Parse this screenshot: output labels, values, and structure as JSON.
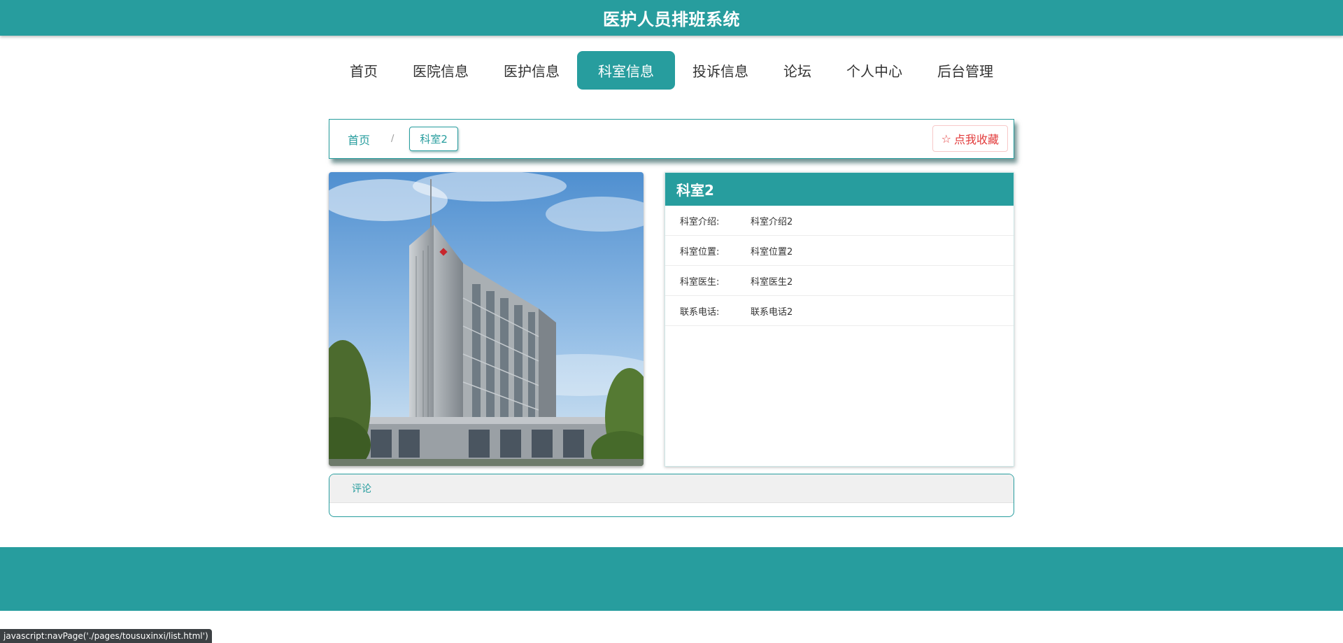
{
  "header": {
    "title": "医护人员排班系统"
  },
  "nav": {
    "items": [
      {
        "label": "首页"
      },
      {
        "label": "医院信息"
      },
      {
        "label": "医护信息"
      },
      {
        "label": "科室信息"
      },
      {
        "label": "投诉信息"
      },
      {
        "label": "论坛"
      },
      {
        "label": "个人中心"
      },
      {
        "label": "后台管理"
      }
    ],
    "active_index": 3
  },
  "breadcrumb": {
    "home": "首页",
    "separator": "/",
    "current": "科室2"
  },
  "favorite": {
    "label": "点我收藏",
    "icon": "star-outline-icon"
  },
  "detail": {
    "title": "科室2",
    "rows": [
      {
        "label": "科室介绍:",
        "value": "科室介绍2"
      },
      {
        "label": "科室位置:",
        "value": "科室位置2"
      },
      {
        "label": "科室医生:",
        "value": "科室医生2"
      },
      {
        "label": "联系电话:",
        "value": "联系电话2"
      }
    ]
  },
  "comments": {
    "tab_label": "评论"
  },
  "status_bar": {
    "url": "javascript:navPage('./pages/tousuxinxi/list.html')"
  },
  "colors": {
    "accent": "#279d9e",
    "favorite": "#e23b3b"
  }
}
